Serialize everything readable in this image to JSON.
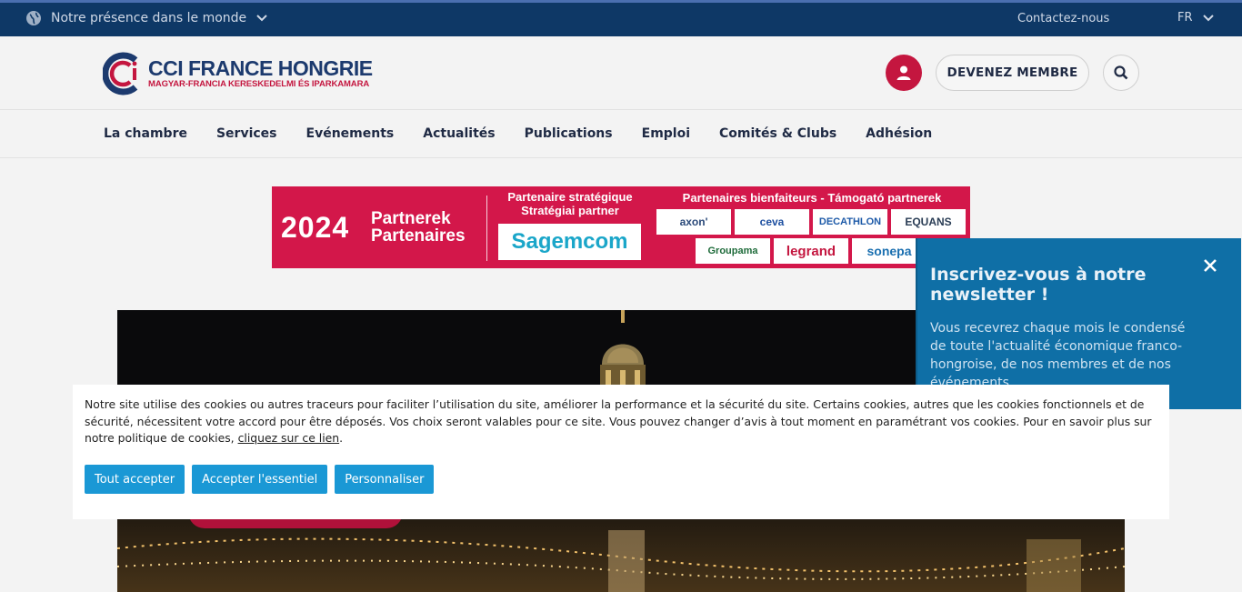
{
  "topbar": {
    "presence_label": "Notre présence dans le monde",
    "contact_label": "Contactez-nous",
    "lang_label": "FR"
  },
  "header": {
    "brand_name": "CCI FRANCE HONGRIE",
    "brand_tagline": "MAGYAR-FRANCIA KERESKEDELMI ÉS IPARKAMARA",
    "member_button": "DEVENEZ MEMBRE"
  },
  "nav": {
    "items": [
      "La chambre",
      "Services",
      "Evénements",
      "Actualités",
      "Publications",
      "Emploi",
      "Comités & Clubs",
      "Adhésion"
    ]
  },
  "banner": {
    "year": "2024",
    "partners_line1": "Partnerek",
    "partners_line2": "Partenaires",
    "strategic_line1": "Partenaire stratégique",
    "strategic_line2": "Stratégiai partner",
    "strategic_partner": "Sagemcom",
    "benefactors_title": "Partenaires bienfaiteurs - Támogató partnerek",
    "benefactor_logos": [
      "axon'",
      "ceva",
      "DECATHLON",
      "EQUANS",
      "Groupama",
      "legrand",
      "sonepa"
    ]
  },
  "newsletter": {
    "title": "Inscrivez-vous à notre newsletter !",
    "text": "Vous recevrez chaque mois le condensé de toute l'actualité économique franco-hongroise, de nos membres et de nos événements."
  },
  "cookie": {
    "text": "Notre site utilise des cookies ou autres traceurs pour faciliter l’utilisation du site, améliorer la performance et la sécurité du site. Certains cookies, autres que les cookies fonctionnels et de sécurité, nécessitent votre accord pour être déposés. Vos choix seront valables pour ce site. Vous pouvez changer d’avis à tout moment en paramétrant vos cookies. Pour en savoir plus sur notre politique de cookies, ",
    "link": "cliquez sur ce lien",
    "after_link": ".",
    "accept_all": "Tout accepter",
    "accept_essential": "Accepter l'essentiel",
    "customize": "Personnaliser"
  },
  "colors": {
    "topbar": "#0e3866",
    "brand_red": "#c4163f",
    "newsletter": "#0f6fa6",
    "cookie_button": "#1a98d5"
  }
}
